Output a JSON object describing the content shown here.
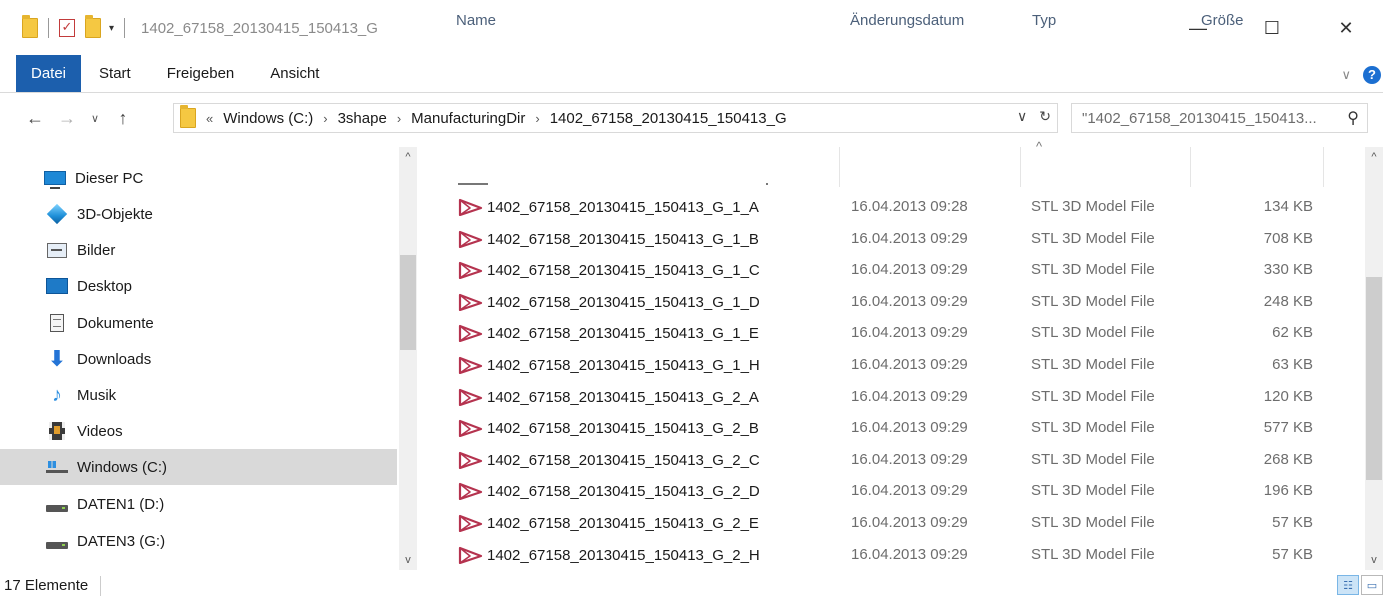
{
  "window": {
    "title": "1402_67158_20130415_150413_G",
    "qa_check": "✓",
    "qa_dropdown": "▾",
    "minimize": "—",
    "maximize": "☐",
    "close": "✕"
  },
  "ribbon": {
    "tabs": [
      "Datei",
      "Start",
      "Freigeben",
      "Ansicht"
    ],
    "expand": "∨",
    "help": "?"
  },
  "nav": {
    "back": "←",
    "forward": "→",
    "recent": "∨",
    "up": "↑",
    "address_overflow": "«",
    "breadcrumbs": [
      "Windows (C:)",
      "3shape",
      "ManufacturingDir",
      "1402_67158_20130415_150413_G"
    ],
    "crumb_sep": "›",
    "dropdown": "∨",
    "refresh": "↻",
    "search_placeholder": "\"1402_67158_20130415_150413...",
    "search_icon": "⚲"
  },
  "sidebar": {
    "items": [
      {
        "label": "Dieser PC",
        "icon": "computer-icon"
      },
      {
        "label": "3D-Objekte",
        "icon": "3d-objects-icon"
      },
      {
        "label": "Bilder",
        "icon": "pictures-icon"
      },
      {
        "label": "Desktop",
        "icon": "desktop-icon"
      },
      {
        "label": "Dokumente",
        "icon": "documents-icon"
      },
      {
        "label": "Downloads",
        "icon": "download-icon"
      },
      {
        "label": "Musik",
        "icon": "music-icon"
      },
      {
        "label": "Videos",
        "icon": "videos-icon"
      },
      {
        "label": "Windows (C:)",
        "icon": "windows-drive-icon",
        "selected": true
      },
      {
        "label": "DATEN1 (D:)",
        "icon": "drive-icon"
      },
      {
        "label": "DATEN3 (G:)",
        "icon": "drive-icon"
      }
    ],
    "scroll_up": "^",
    "scroll_down": "v"
  },
  "filelist": {
    "columns": {
      "name": "Name",
      "date": "Änderungsdatum",
      "type": "Typ",
      "size": "Größe"
    },
    "sort_caret": "^",
    "scroll_up": "^",
    "scroll_down": "v",
    "rows": [
      {
        "name": "1402_67158_20130415_150413_G_1_A",
        "date": "16.04.2013 09:28",
        "type": "STL 3D Model File",
        "size": "134 KB"
      },
      {
        "name": "1402_67158_20130415_150413_G_1_B",
        "date": "16.04.2013 09:29",
        "type": "STL 3D Model File",
        "size": "708 KB"
      },
      {
        "name": "1402_67158_20130415_150413_G_1_C",
        "date": "16.04.2013 09:29",
        "type": "STL 3D Model File",
        "size": "330 KB"
      },
      {
        "name": "1402_67158_20130415_150413_G_1_D",
        "date": "16.04.2013 09:29",
        "type": "STL 3D Model File",
        "size": "248 KB"
      },
      {
        "name": "1402_67158_20130415_150413_G_1_E",
        "date": "16.04.2013 09:29",
        "type": "STL 3D Model File",
        "size": "62 KB"
      },
      {
        "name": "1402_67158_20130415_150413_G_1_H",
        "date": "16.04.2013 09:29",
        "type": "STL 3D Model File",
        "size": "63 KB"
      },
      {
        "name": "1402_67158_20130415_150413_G_2_A",
        "date": "16.04.2013 09:29",
        "type": "STL 3D Model File",
        "size": "120 KB"
      },
      {
        "name": "1402_67158_20130415_150413_G_2_B",
        "date": "16.04.2013 09:29",
        "type": "STL 3D Model File",
        "size": "577 KB"
      },
      {
        "name": "1402_67158_20130415_150413_G_2_C",
        "date": "16.04.2013 09:29",
        "type": "STL 3D Model File",
        "size": "268 KB"
      },
      {
        "name": "1402_67158_20130415_150413_G_2_D",
        "date": "16.04.2013 09:29",
        "type": "STL 3D Model File",
        "size": "196 KB"
      },
      {
        "name": "1402_67158_20130415_150413_G_2_E",
        "date": "16.04.2013 09:29",
        "type": "STL 3D Model File",
        "size": "57 KB"
      },
      {
        "name": "1402_67158_20130415_150413_G_2_H",
        "date": "16.04.2013 09:29",
        "type": "STL 3D Model File",
        "size": "57 KB"
      }
    ]
  },
  "statusbar": {
    "count": "17 Elemente",
    "details_view_icon": "☷",
    "tiles_view_icon": "▭"
  },
  "colors": {
    "file_tab": "#1c5fad",
    "stl_icon": "#b5334f",
    "selected_nav": "#d9d9d9",
    "column_header": "#4c607a"
  }
}
